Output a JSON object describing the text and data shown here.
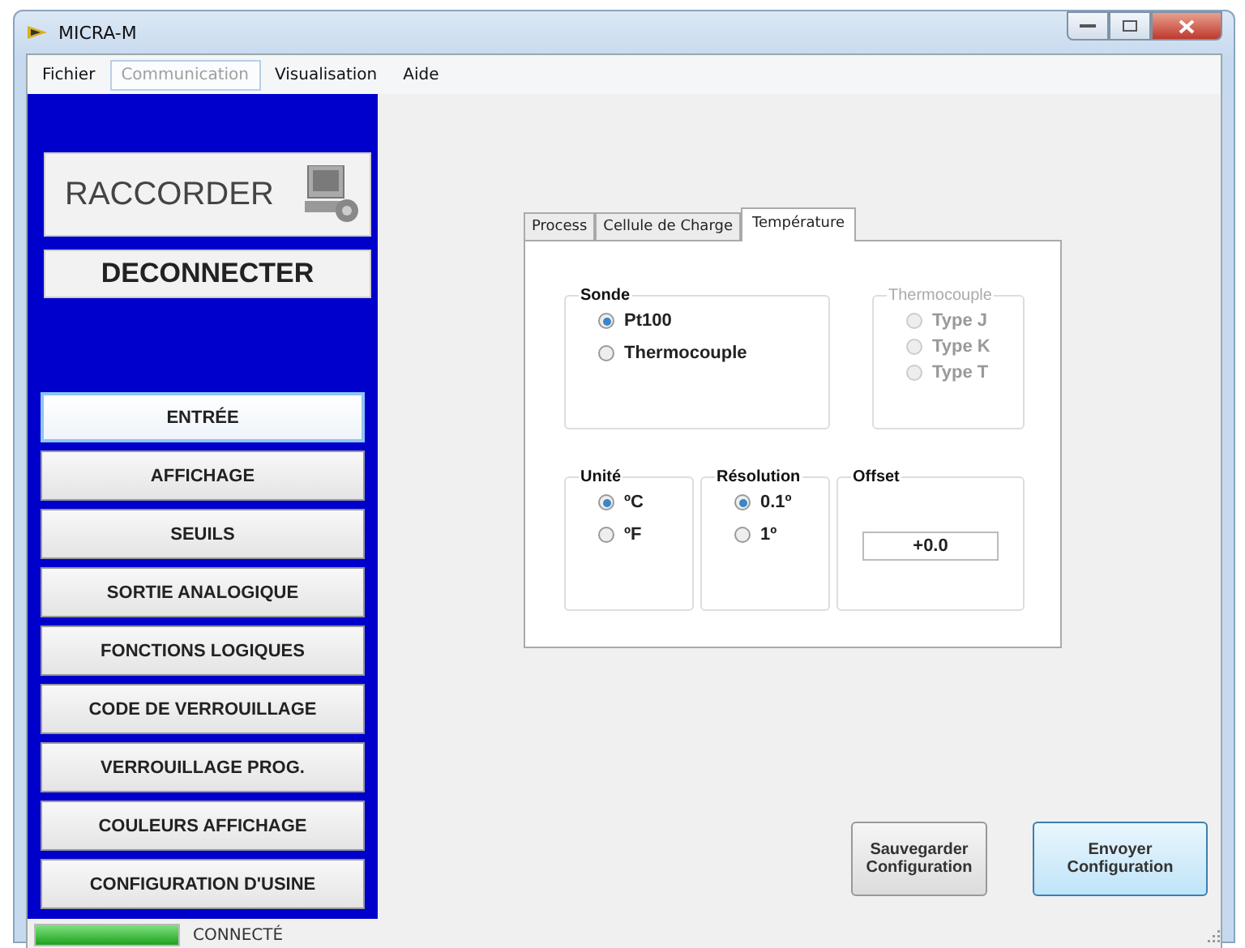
{
  "window": {
    "title": "MICRA-M"
  },
  "menu": [
    {
      "label": "Fichier",
      "disabled": false
    },
    {
      "label": "Communication",
      "disabled": true
    },
    {
      "label": "Visualisation",
      "disabled": false
    },
    {
      "label": "Aide",
      "disabled": false
    }
  ],
  "sidebar": {
    "connect_button": "RACCORDER",
    "disconnect_button": "DECONNECTER",
    "items": [
      {
        "label": "ENTRÉE",
        "selected": true
      },
      {
        "label": "AFFICHAGE",
        "selected": false
      },
      {
        "label": "SEUILS",
        "selected": false
      },
      {
        "label": "SORTIE ANALOGIQUE",
        "selected": false
      },
      {
        "label": "FONCTIONS LOGIQUES",
        "selected": false
      },
      {
        "label": "CODE DE VERROUILLAGE",
        "selected": false
      },
      {
        "label": "VERROUILLAGE PROG.",
        "selected": false
      },
      {
        "label": "COULEURS AFFICHAGE",
        "selected": false
      },
      {
        "label": "CONFIGURATION D'USINE",
        "selected": false
      }
    ]
  },
  "tabs": [
    {
      "label": "Process",
      "selected": false
    },
    {
      "label": "Cellule de Charge",
      "selected": false
    },
    {
      "label": "Température",
      "selected": true
    }
  ],
  "groups": [
    {
      "kind": "radio",
      "title": "Sonde",
      "disabled": false,
      "options": [
        {
          "label": "Pt100",
          "selected": true
        },
        {
          "label": "Thermocouple",
          "selected": false
        }
      ]
    },
    {
      "kind": "radio",
      "title": "Thermocouple",
      "disabled": true,
      "options": [
        {
          "label": "Type J",
          "selected": false
        },
        {
          "label": "Type K",
          "selected": false
        },
        {
          "label": "Type T",
          "selected": false
        }
      ]
    },
    {
      "kind": "radio",
      "title": "Unité",
      "disabled": false,
      "options": [
        {
          "label": "ºC",
          "selected": true
        },
        {
          "label": "ºF",
          "selected": false
        }
      ]
    },
    {
      "kind": "radio",
      "title": "Résolution",
      "disabled": false,
      "options": [
        {
          "label": "0.1º",
          "selected": true
        },
        {
          "label": "1º",
          "selected": false
        }
      ]
    },
    {
      "kind": "field",
      "title": "Offset",
      "disabled": false,
      "value": "+0.0"
    }
  ],
  "buttons": [
    {
      "label": "Sauvegarder Configuration",
      "focused": false
    },
    {
      "label": "Envoyer Configuration",
      "focused": true
    }
  ],
  "status_bar": {
    "level": 1,
    "text": "CONNECTÉ"
  }
}
